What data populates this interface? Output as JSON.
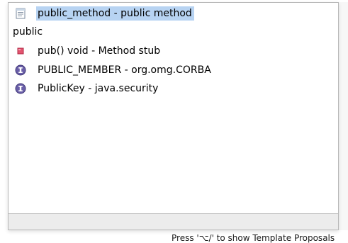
{
  "proposals": [
    {
      "label": "public_method - public method",
      "icon": "template-doc-icon",
      "selected": true
    },
    {
      "label": "public",
      "icon": "",
      "selected": false
    },
    {
      "label": "pub()  void - Method stub",
      "icon": "method-private-square-icon",
      "selected": false
    },
    {
      "label": "PUBLIC_MEMBER - org.omg.CORBA",
      "icon": "interface-icon",
      "selected": false
    },
    {
      "label": "PublicKey - java.security",
      "icon": "interface-icon",
      "selected": false
    }
  ],
  "status": {
    "hint": "Press '⌥/' to show Template Proposals"
  },
  "colors": {
    "selection": "#b7d3f2",
    "interface_badge": "#6a5fa8",
    "method_square": "#e3546f"
  }
}
